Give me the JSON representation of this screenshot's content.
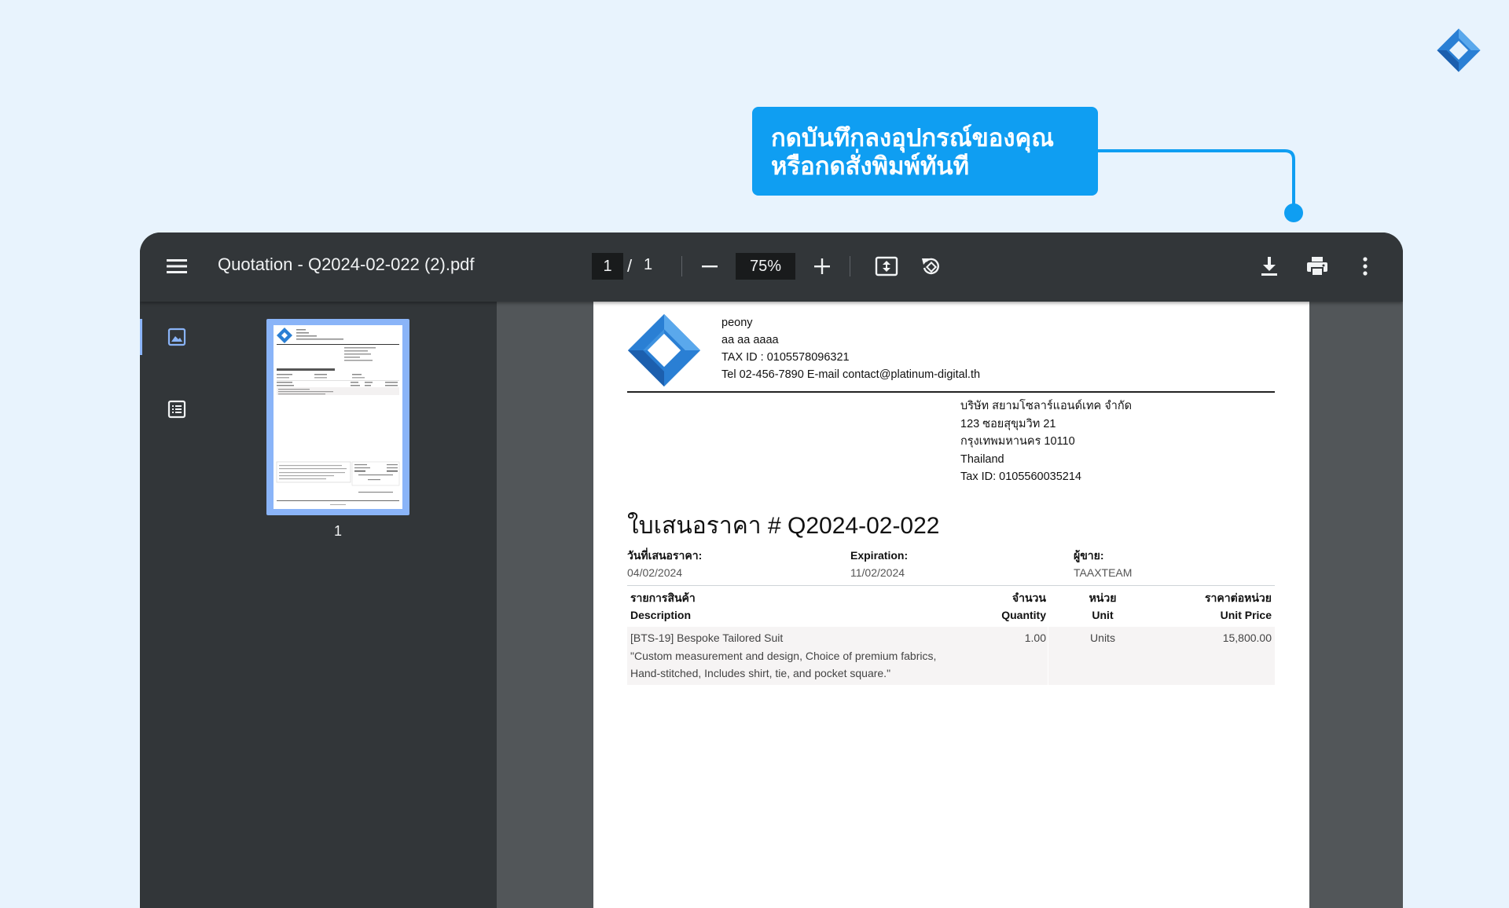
{
  "callout": {
    "line1": "กดบันทึกลงอุปกรณ์ของคุณ",
    "line2": "หรือกดสั่งพิมพ์ทันที"
  },
  "colors": {
    "background": "#e8f3fd",
    "callout": "#0f9ef2",
    "toolbar": "#323639",
    "doc_area": "#525659",
    "thumb_highlight": "#8ab4f8",
    "logo_blue": "#2a7fd4"
  },
  "toolbar": {
    "menu_icon": "hamburger-menu-icon",
    "title": "Quotation - Q2024-02-022 (2).pdf",
    "page_current": "1",
    "page_separator": "/",
    "page_total": "1",
    "zoom_out_icon": "minus-icon",
    "zoom_level": "75%",
    "zoom_in_icon": "plus-icon",
    "fit_icon": "fit-to-page-icon",
    "rotate_icon": "rotate-icon",
    "download_icon": "download-icon",
    "print_icon": "print-icon",
    "more_icon": "more-vertical-icon"
  },
  "sidebar": {
    "thumbnails_icon": "image-icon",
    "outline_icon": "outline-list-icon",
    "thumbnail_page_label": "1"
  },
  "document": {
    "company": {
      "name": "peony",
      "address": "aa aa aaaa",
      "tax": "TAX ID : 0105578096321",
      "contact": "Tel 02-456-7890 E-mail contact@platinum-digital.th"
    },
    "customer": {
      "name": "บริษัท สยามโซลาร์แอนด์เทค จำกัด",
      "street": "123 ซอยสุขุมวิท 21",
      "city": "กรุงเทพมหานคร 10110",
      "country": "Thailand",
      "tax": "Tax ID: 0105560035214"
    },
    "heading": "ใบเสนอราคา # Q2024-02-022",
    "quote_date_label": "วันที่เสนอราคา:",
    "quote_date": "04/02/2024",
    "expiration_label": "Expiration:",
    "expiration": "11/02/2024",
    "seller_label": "ผู้ขาย:",
    "seller": "TAAXTEAM",
    "table": {
      "headers": [
        {
          "th": "รายการสินค้า",
          "en": "Description"
        },
        {
          "th": "จำนวน",
          "en": "Quantity"
        },
        {
          "th": "หน่วย",
          "en": "Unit"
        },
        {
          "th": "ราคาต่อหน่วย",
          "en": "Unit Price"
        }
      ],
      "rows": [
        {
          "line1": "[BTS-19] Bespoke Tailored Suit",
          "line2": "\"Custom measurement and design, Choice of premium fabrics,",
          "line3": "Hand-stitched, Includes shirt, tie, and pocket square.\"",
          "quantity": "1.00",
          "unit": "Units",
          "unit_price": "15,800.00"
        }
      ]
    }
  }
}
